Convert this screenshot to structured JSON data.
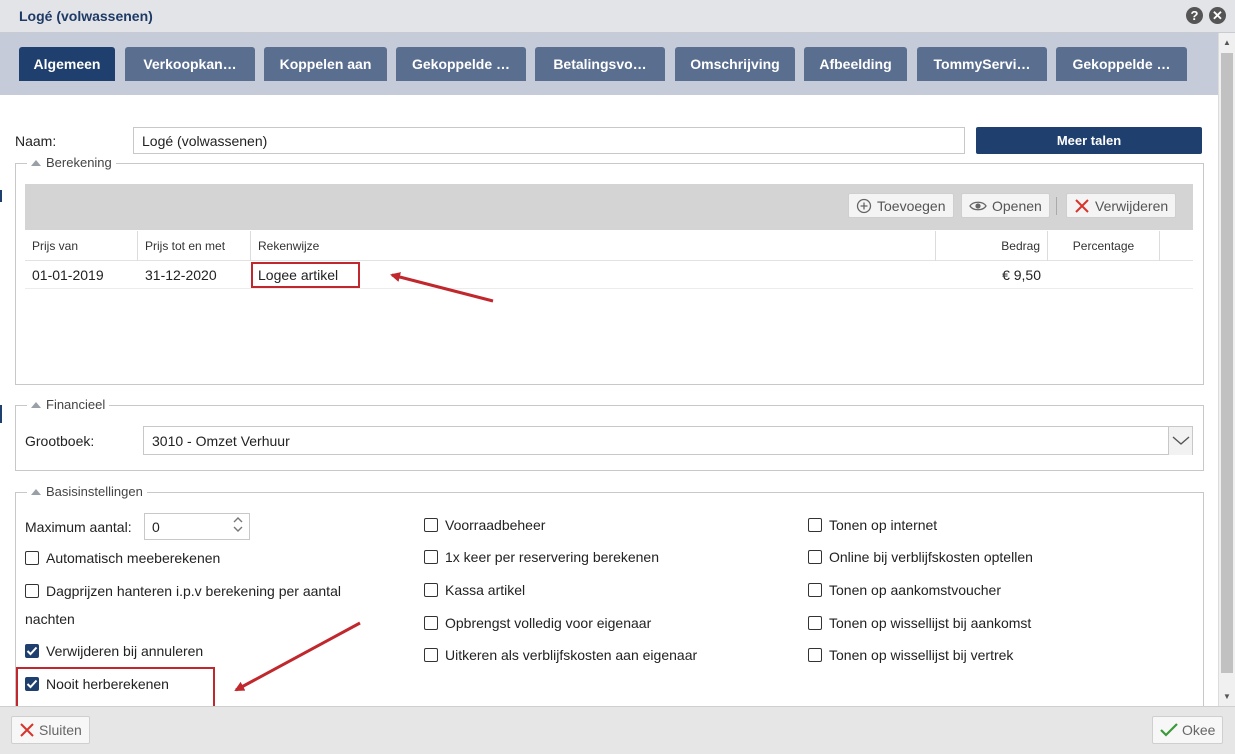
{
  "window": {
    "title": "Logé (volwassenen)",
    "help_icon": "help-icon",
    "close_icon": "close-icon"
  },
  "tabs": [
    {
      "label": "Algemeen",
      "active": true
    },
    {
      "label": "Verkoopkan…"
    },
    {
      "label": "Koppelen aan"
    },
    {
      "label": "Gekoppelde …"
    },
    {
      "label": "Betalingsvo…"
    },
    {
      "label": "Omschrijving"
    },
    {
      "label": "Afbeelding"
    },
    {
      "label": "TommyServi…"
    },
    {
      "label": "Gekoppelde …"
    }
  ],
  "naam": {
    "label": "Naam:",
    "value": "Logé (volwassenen)",
    "more_languages": "Meer talen"
  },
  "berekening": {
    "legend": "Berekening",
    "toolbar": {
      "add": "Toevoegen",
      "open": "Openen",
      "delete": "Verwijderen"
    },
    "columns": [
      "Prijs van",
      "Prijs tot en met",
      "Rekenwijze",
      "Bedrag",
      "Percentage"
    ],
    "rows": [
      {
        "prijs_van": "01-01-2019",
        "prijs_tot": "31-12-2020",
        "rekenwijze": "Logee artikel",
        "bedrag": "€ 9,50",
        "percentage": ""
      }
    ]
  },
  "financieel": {
    "legend": "Financieel",
    "label": "Grootboek:",
    "value": "3010 - Omzet Verhuur"
  },
  "basis": {
    "legend": "Basisinstellingen",
    "max_label": "Maximum aantal:",
    "max_value": "0",
    "col1": [
      {
        "label": "Automatisch meeberekenen",
        "checked": false
      },
      {
        "label": "Dagprijzen hanteren i.p.v berekening per aantal",
        "label2": "nachten",
        "checked": false
      },
      {
        "label": "Verwijderen bij annuleren",
        "checked": true
      },
      {
        "label": "Nooit herberekenen",
        "checked": true
      }
    ],
    "col2": [
      {
        "label": "Voorraadbeheer",
        "checked": false
      },
      {
        "label": "1x keer per reservering berekenen",
        "checked": false
      },
      {
        "label": "Kassa artikel",
        "checked": false
      },
      {
        "label": "Opbrengst volledig voor eigenaar",
        "checked": false
      },
      {
        "label": "Uitkeren als verblijfskosten aan eigenaar",
        "checked": false
      }
    ],
    "col3": [
      {
        "label": "Tonen op internet",
        "checked": false
      },
      {
        "label": "Online bij verblijfskosten optellen",
        "checked": false
      },
      {
        "label": "Tonen op aankomstvoucher",
        "checked": false
      },
      {
        "label": "Tonen op wissellijst bij aankomst",
        "checked": false
      },
      {
        "label": "Tonen op wissellijst bij vertrek",
        "checked": false
      }
    ]
  },
  "footer": {
    "close": "Sluiten",
    "ok": "Okee"
  },
  "colors": {
    "accent": "#1f3f6e",
    "tab": "#5a6e90",
    "annotation": "#c0282d"
  }
}
